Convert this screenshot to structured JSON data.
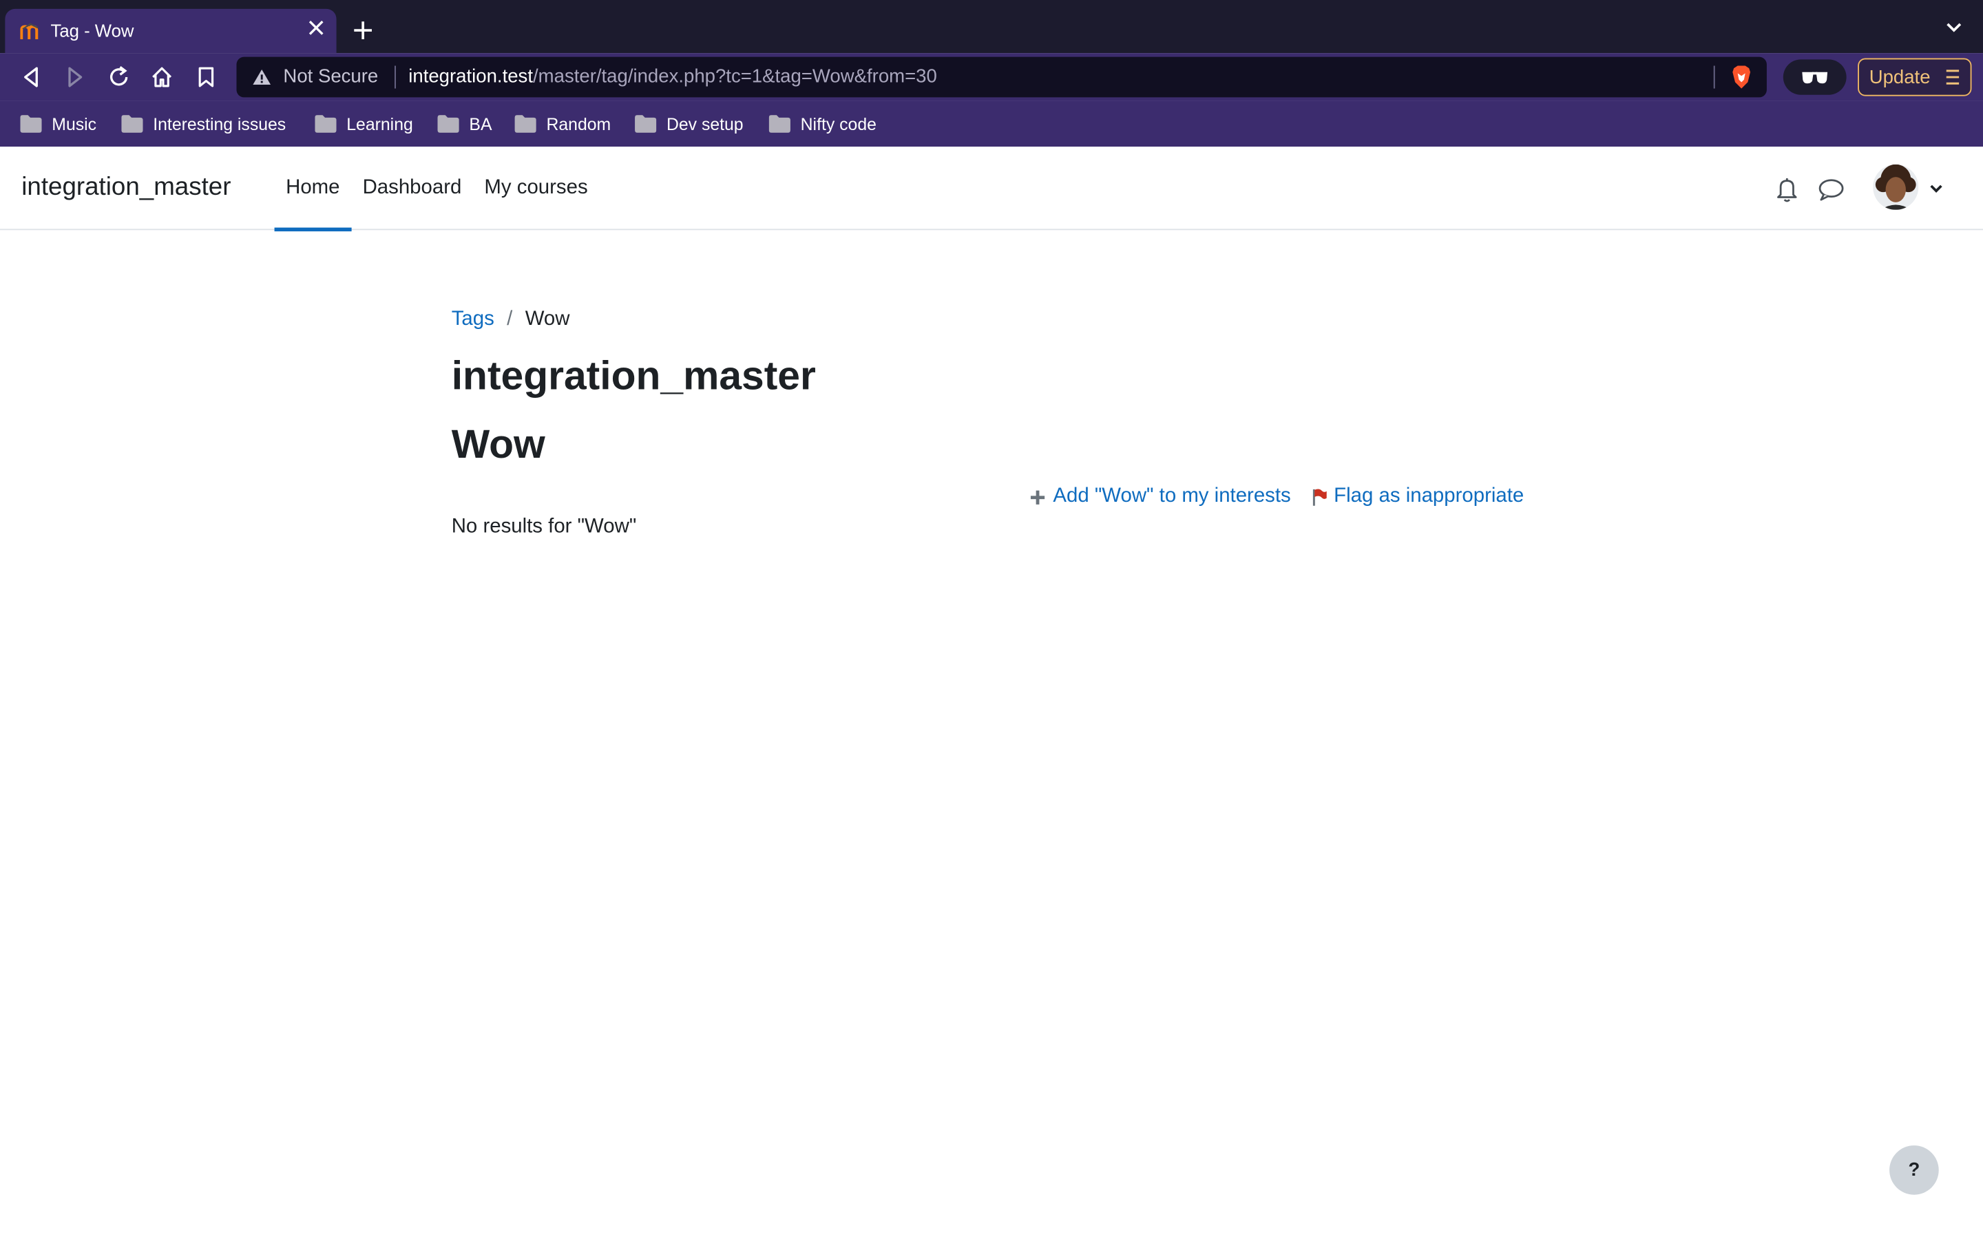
{
  "browser": {
    "tab": {
      "title": "Tag - Wow"
    },
    "address": {
      "security_label": "Not Secure",
      "host": "integration.test",
      "path": "/master/tag/index.php?tc=1&tag=Wow&from=30"
    },
    "update_label": "Update",
    "bookmarks": [
      "Music",
      "Interesting issues",
      "Learning",
      "BA",
      "Random",
      "Dev setup",
      "Nifty code"
    ]
  },
  "site": {
    "name": "integration_master",
    "nav": [
      "Home",
      "Dashboard",
      "My courses"
    ],
    "active_nav": "Home",
    "accent_color": "#0f6cbf"
  },
  "page": {
    "breadcrumb": {
      "link": "Tags",
      "separator": "/",
      "current": "Wow"
    },
    "heading": "integration_master",
    "tag_name": "Wow",
    "actions": {
      "add_interest": "Add \"Wow\" to my interests",
      "flag": "Flag as inappropriate"
    },
    "no_results": "No results for \"Wow\""
  },
  "help": {
    "label": "?"
  }
}
